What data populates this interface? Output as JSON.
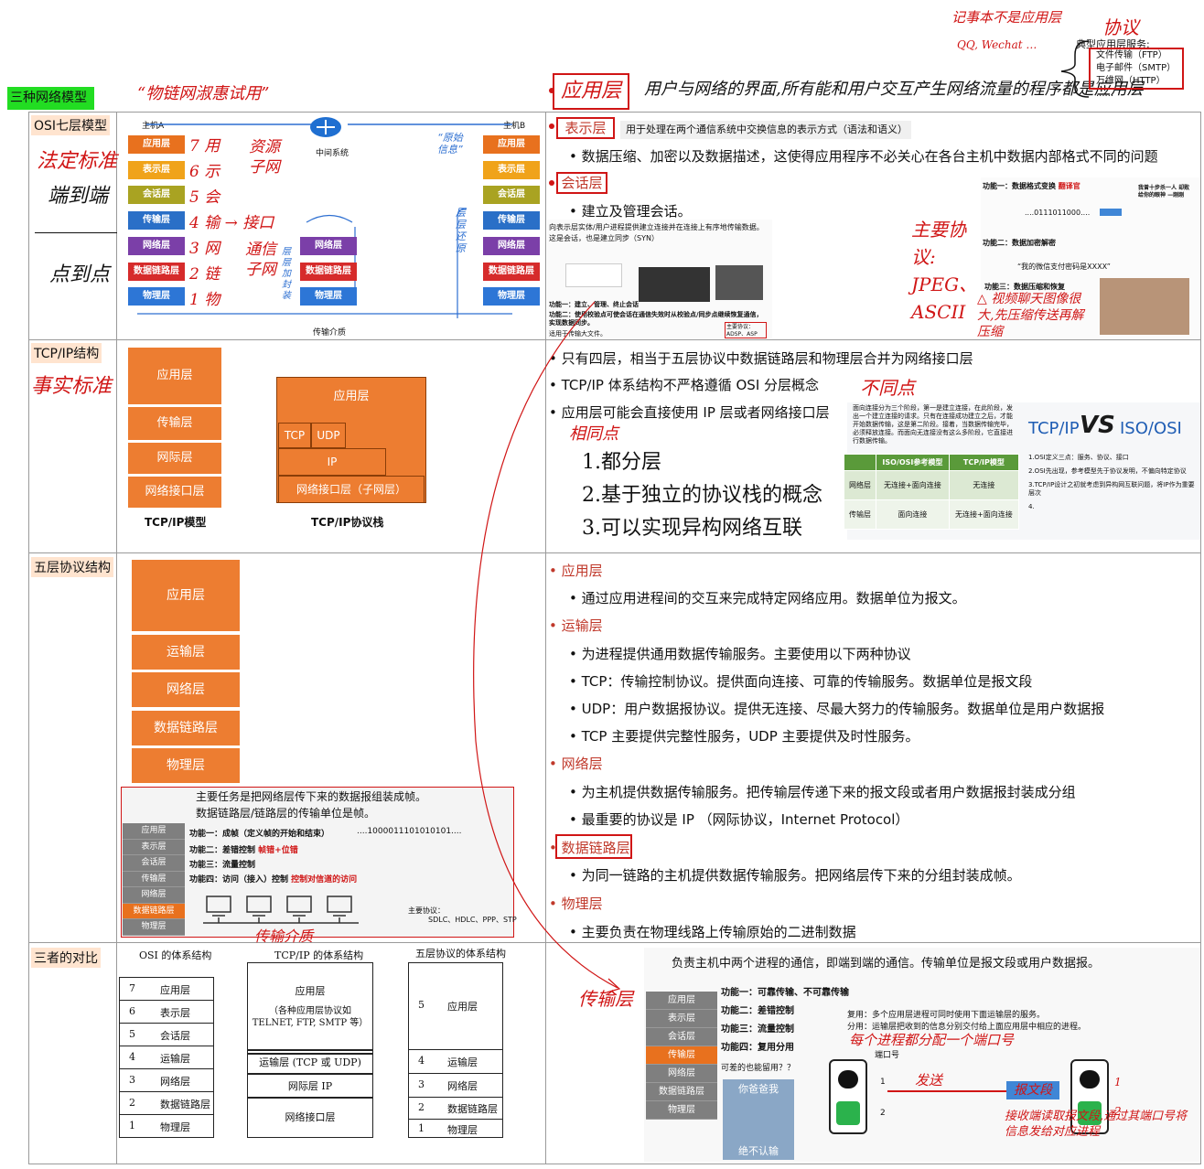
{
  "top": {
    "green_title": "三种网络模型",
    "hand_note_osi": "“物链网淑惠试用”",
    "app_layer_box": "应用层",
    "app_layer_hand": "用户与网络的界面,所有能和用户交互产生网络流量的程序都是应用层",
    "hand_qq": "记事本不是应用层",
    "hand_qq2": "QQ, Wechat …",
    "hand_xieyi": "协议",
    "typical_title": "典型应用层服务:",
    "typical_items": [
      "文件传输（FTP）",
      "电子邮件（SMTP）",
      "万维网（HTTP）",
      "......"
    ]
  },
  "sections": {
    "osi": "OSI七层模型",
    "tcpip": "TCP/IP结构",
    "five": "五层协议结构",
    "compare": "三者的对比"
  },
  "osi_diagram": {
    "host_a": "主机A",
    "host_b": "主机B",
    "middle": "中间系统",
    "medium": "传输介质",
    "layers": [
      "应用层",
      "表示层",
      "会话层",
      "传输层",
      "网络层",
      "数据链路层",
      "物理层"
    ],
    "mid_layers": [
      "网络层",
      "数据链路层",
      "物理层"
    ],
    "hand_fading": "法定标准",
    "hand_duan": "端到端",
    "hand_dian": "点到点",
    "hand_nums": [
      "7 用",
      "6 示",
      "5 会",
      "4 输 → 接口",
      "3 网",
      "2 链",
      "1 物"
    ],
    "hand_ziyuan": "资源子网",
    "hand_tongxin": "通信子网",
    "hand_yuanshi": "“原始信息”",
    "hand_cengceng_a": "层层加封装",
    "hand_cengceng_b": "层层还原"
  },
  "tcpip_diagram": {
    "model_layers": [
      "应用层",
      "传输层",
      "网际层",
      "网络接口层"
    ],
    "model_label": "TCP/IP模型",
    "stack_app": "应用层",
    "stack_tcp": "TCP",
    "stack_udp": "UDP",
    "stack_ip": "IP",
    "stack_if": "网络接口层（子网层）",
    "stack_label": "TCP/IP协议栈",
    "hand_shishi": "事实标准"
  },
  "five_diagram": {
    "layers": [
      "应用层",
      "运输层",
      "网络层",
      "数据链路层",
      "物理层"
    ],
    "dl_line1": "主要任务是把网络层传下来的数据报组装成帧。",
    "dl_line2": "数据链路层/链路层的传输单位是帧。",
    "gray_rows": [
      "应用层",
      "表示层",
      "会话层",
      "传输层",
      "网络层",
      "数据链路层",
      "物理层"
    ],
    "func1": "功能一：成帧（定义帧的开始和结束）",
    "bits": "....1000011101010101....",
    "func2": "功能二：差错控制",
    "func2_red": "帧错+位错",
    "func3": "功能三：流量控制",
    "func4": "功能四：访问（接入）控制",
    "func4_red": "控制对信道的访问",
    "protocols_title": "主要协议：",
    "protocols": "SDLC、HDLC、PPP、STP",
    "hand_medium": "传输介质"
  },
  "compare_diagram": {
    "osi_title": "OSI 的体系结构",
    "tcp_title": "TCP/IP 的体系结构",
    "five_title": "五层协议的体系结构",
    "osi_rows": [
      {
        "n": "7",
        "t": "应用层"
      },
      {
        "n": "6",
        "t": "表示层"
      },
      {
        "n": "5",
        "t": "会话层"
      },
      {
        "n": "4",
        "t": "运输层"
      },
      {
        "n": "3",
        "t": "网络层"
      },
      {
        "n": "2",
        "t": "数据链路层"
      },
      {
        "n": "1",
        "t": "物理层"
      }
    ],
    "tcp_app": "应用层",
    "tcp_app_sub": "（各种应用层协议如 TELNET, FTP, SMTP 等）",
    "tcp_transport": "运输层 (TCP 或 UDP)",
    "tcp_ip": "网际层 IP",
    "tcp_if": "网络接口层",
    "five_rows": [
      {
        "n": "5",
        "t": "应用层"
      },
      {
        "n": "4",
        "t": "运输层"
      },
      {
        "n": "3",
        "t": "网络层"
      },
      {
        "n": "2",
        "t": "数据链路层"
      },
      {
        "n": "1",
        "t": "物理层"
      }
    ]
  },
  "right_osi": {
    "present_box": "表示层",
    "present_desc": "用于处理在两个通信系统中交换信息的表示方式（语法和语义）",
    "present_bullet": "数据压缩、加密以及数据描述，这使得应用程序不必关心在各台主机中数据内部格式不同的问题",
    "session_box": "会话层",
    "session_bullet": "建立及管理会话。",
    "session_img_l1": "向表示层实体/用户进程提供建立连接并在连接上有序地传输数据。",
    "session_img_l2": "这是会话，也是建立同步（SYN）",
    "session_img_f1": "功能一：建立、管理、终止会话",
    "session_img_f2": "功能二：使用校验点可使会话在通信失效时从校验点/同步点继续恢复通信，实现数据同步。",
    "session_img_f3": "适用于传输大文件。",
    "session_img_proto": "主要协议：ADSP、ASP",
    "pres_f1": "功能一：数据格式变换",
    "pres_f1_red": "翻译官",
    "pres_bits": "....0111011000....",
    "pres_meme": "我曾十步杀一人 却败给你的眼神 —刚刚",
    "pres_f2": "功能二：数据加密解密",
    "pres_quote": "“我的微信支付密码是XXXX”",
    "pres_f3": "功能三：数据压缩和恢复",
    "hand_proto": "主要协议: JPEG、ASCII",
    "hand_video": "△ 视频聊天图像很大,先压缩传送再解压缩"
  },
  "right_tcpip": {
    "b1": "只有四层，相当于五层协议中数据链路层和物理层合并为网络接口层",
    "b2": "TCP/IP 体系结构不严格遵循 OSI 分层概念",
    "b3": "应用层可能会直接使用 IP 层或者网络接口层",
    "hand_diff": "不同点",
    "hand_same": "相同点",
    "same": [
      "1.都分层",
      "2.基于独立的协议栈的概念",
      "3.可以实现异构网络互联"
    ],
    "diff_text": "面向连接分为三个阶段，第一是建立连接，在此阶段，发出一个建立连接的请求。只有在连接成功建立之后，才能开始数据传输，这是第二阶段。接着，当数据传输完毕，必须释放连接。而面向无连接没有这么多阶段，它直接进行数据传输。",
    "table_head": [
      "",
      "ISO/OSI参考模型",
      "TCP/IP模型"
    ],
    "table_rows": [
      [
        "网络层",
        "无连接+面向连接",
        "无连接"
      ],
      [
        "传输层",
        "面向连接",
        "无连接+面向连接"
      ]
    ],
    "vs_left": "TCP/IP",
    "vs_mid": "VS",
    "vs_right": "ISO/OSI",
    "vs_p1": "1.OSI定义三点：服务、协议、接口",
    "vs_p2": "2.OSI先出现，参考模型先于协议发明，不偏向特定协议",
    "vs_p3": "3.TCP/IP设计之初就考虑到异构网互联问题，将IP作为重要层次",
    "vs_p4": "4."
  },
  "right_five": {
    "h_app": "应用层",
    "app_b": "通过应用进程间的交互来完成特定网络应用。数据单位为报文。",
    "h_tra": "运输层",
    "tra_b1": "为进程提供通用数据传输服务。主要使用以下两种协议",
    "tra_b2": "TCP：传输控制协议。提供面向连接、可靠的传输服务。数据单位是报文段",
    "tra_b3": "UDP：用户数据报协议。提供无连接、尽最大努力的传输服务。数据单位是用户数据报",
    "tra_b4": "TCP 主要提供完整性服务，UDP 主要提供及时性服务。",
    "h_net": "网络层",
    "net_b1": "为主机提供数据传输服务。把传输层传递下来的报文段或者用户数据报封装成分组",
    "net_b2": "最重要的协议是 IP （网际协议，Internet Protocol）",
    "h_dl": "数据链路层",
    "dl_b": "为同一链路的主机提供数据传输服务。把网络层传下来的分组封装成帧。",
    "h_ph": "物理层",
    "ph_b": "主要负责在物理线路上传输原始的二进制数据"
  },
  "right_compare": {
    "header": "负责主机中两个进程的通信，即端到端的通信。传输单位是报文段或用户数据报。",
    "gray_rows": [
      "应用层",
      "表示层",
      "会话层",
      "传输层",
      "网络层",
      "数据链路层",
      "物理层"
    ],
    "f1": "功能一：可靠传输、不可靠传输",
    "f2": "功能二：差错控制",
    "f3": "功能三：流量控制",
    "f4": "功能四：复用分用",
    "mux": "复用：多个应用层进程可同时使用下面运输层的服务。",
    "demux": "分用：运输层把收到的信息分别交付给上面应用层中相应的进程。",
    "hand_port": "每个进程都分配一个端口号",
    "port": "端口号",
    "question": "可差的也能留用？？",
    "meme_top": "你爸爸我",
    "meme_bottom": "绝不认输",
    "hand_transport": "传输层",
    "hand_send": "发送",
    "hand_seg": "报文段",
    "hand_recv": "接收端读取报文段,通过其端口号将信息发给对应进程",
    "n1": "1",
    "n2": "2",
    "n1b": "1",
    "n2b": "2"
  }
}
